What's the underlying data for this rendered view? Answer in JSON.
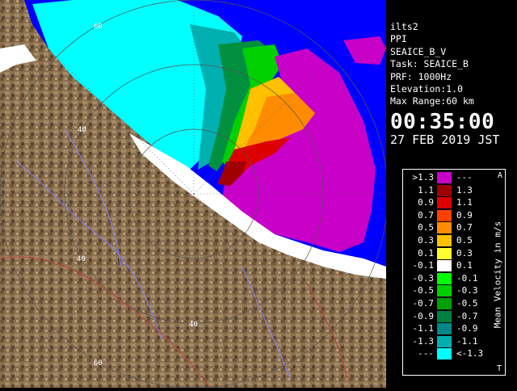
{
  "info": {
    "station": "ilts2",
    "product": "PPI",
    "dataset": "SEAICE_B_V",
    "task": "Task: SEAICE_B",
    "prf": "PRF: 1000Hz",
    "elevation": "Elevation:1.0",
    "max_range": "Max Range:60 km",
    "time": "00:35:00",
    "date": "27 FEB 2019 JST"
  },
  "range_labels": [
    "60",
    "40",
    "40",
    "40",
    "60"
  ],
  "legend": {
    "title": "Mean Velocity in m/s",
    "corner_top": "A",
    "corner_bottom": "T",
    "rows": [
      {
        "left": ">1.3",
        "right": "---",
        "color": "#c800c8"
      },
      {
        "left": "1.1",
        "right": "1.3",
        "color": "#a00000"
      },
      {
        "left": "0.9",
        "right": "1.1",
        "color": "#dc0000"
      },
      {
        "left": "0.7",
        "right": "0.9",
        "color": "#ff4000"
      },
      {
        "left": "0.5",
        "right": "0.7",
        "color": "#ff8c00"
      },
      {
        "left": "0.3",
        "right": "0.5",
        "color": "#ffc000"
      },
      {
        "left": "0.1",
        "right": "0.3",
        "color": "#ffff30"
      },
      {
        "left": "-0.1",
        "right": "0.1",
        "color": "#ffffff"
      },
      {
        "left": "-0.3",
        "right": "-0.1",
        "color": "#00ff00"
      },
      {
        "left": "-0.5",
        "right": "-0.3",
        "color": "#00d000"
      },
      {
        "left": "-0.7",
        "right": "-0.5",
        "color": "#00a000"
      },
      {
        "left": "-0.9",
        "right": "-0.7",
        "color": "#008040"
      },
      {
        "left": "-1.1",
        "right": "-0.9",
        "color": "#008888"
      },
      {
        "left": "-1.3",
        "right": "-1.1",
        "color": "#00b0b0"
      },
      {
        "left": "---",
        "right": "<-1.3",
        "color": "#00ffff"
      }
    ]
  }
}
